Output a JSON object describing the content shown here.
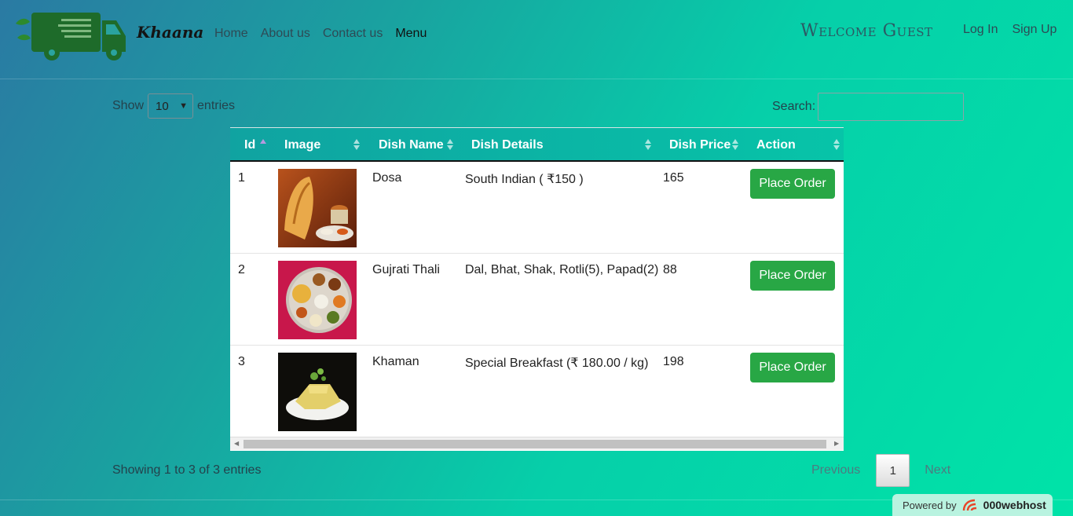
{
  "nav": {
    "brand": "Khaana",
    "links": [
      {
        "label": "Home"
      },
      {
        "label": "About us"
      },
      {
        "label": "Contact us"
      },
      {
        "label": "Menu",
        "active": true
      }
    ],
    "welcome": "Welcome Guest",
    "login": "Log In",
    "signup": "Sign Up"
  },
  "table_controls": {
    "show_label": "Show",
    "entries_value": "10",
    "entries_label": "entries",
    "search_label": "Search:",
    "search_value": ""
  },
  "table": {
    "columns": [
      "Id",
      "Image",
      "Dish Name",
      "Dish Details",
      "Dish Price",
      "Action"
    ],
    "sorted_column": "Id",
    "rows": [
      {
        "id": "1",
        "image_icon": "dosa-image",
        "name": "Dosa",
        "details": "South Indian ( ₹150 )",
        "price": "165",
        "action": "Place Order"
      },
      {
        "id": "2",
        "image_icon": "gujrati-thali-image",
        "name": "Gujrati Thali",
        "details": "Dal, Bhat, Shak, Rotli(5), Papad(2)",
        "price": "88",
        "action": "Place Order"
      },
      {
        "id": "3",
        "image_icon": "khaman-image",
        "name": "Khaman",
        "details": "Special Breakfast (₹ 180.00 / kg)",
        "price": "198",
        "action": "Place Order"
      }
    ]
  },
  "pagination": {
    "info": "Showing 1 to 3 of 3 entries",
    "previous": "Previous",
    "current_page": "1",
    "next": "Next"
  },
  "badge": {
    "powered_by": "Powered by",
    "host": "000webhost"
  },
  "colors": {
    "accent_green": "#28a745",
    "header_teal": "#10a3a1",
    "logo_green": "#1e6b2a"
  }
}
